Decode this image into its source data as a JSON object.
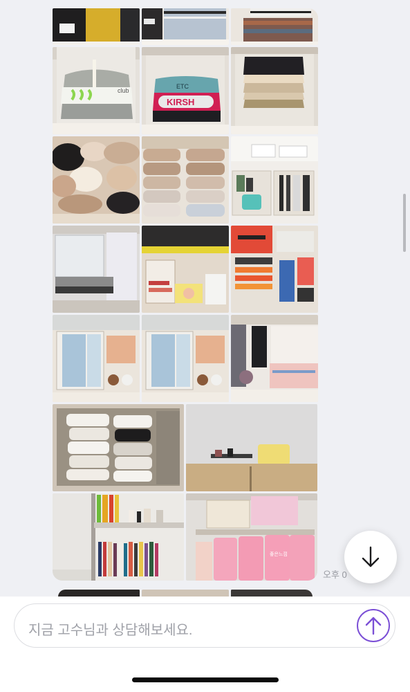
{
  "chat": {
    "timestamp": "오후 0",
    "photos": [
      {
        "name": "photo-folded-black-yellow-knits"
      },
      {
        "name": "photo-striped-knits-drawer"
      },
      {
        "name": "photo-folded-colorful-knits"
      },
      {
        "name": "photo-folded-sweatshirts-shelf"
      },
      {
        "name": "photo-kirsh-sweatshirt-shelf"
      },
      {
        "name": "photo-folded-dark-beige-tops"
      },
      {
        "name": "photo-underwear-drawer"
      },
      {
        "name": "photo-fleece-socks-drawer"
      },
      {
        "name": "photo-cosmetics-organizer"
      },
      {
        "name": "photo-plastic-bags-drawer"
      },
      {
        "name": "photo-mixed-items-drawer"
      },
      {
        "name": "photo-stationery-drawer"
      },
      {
        "name": "photo-masks-drawer-1"
      },
      {
        "name": "photo-masks-drawer-2"
      },
      {
        "name": "photo-bags-shelf"
      },
      {
        "name": "photo-towels-basket"
      },
      {
        "name": "photo-desk-corner"
      },
      {
        "name": "photo-bookshelf-perfume"
      },
      {
        "name": "photo-pink-boxes-shelf"
      }
    ],
    "photo_labels": {
      "club": "club",
      "etc": "ETC",
      "kirsh": "KIRSH",
      "brand_box": "좋은느낌"
    }
  },
  "composer": {
    "placeholder": "지금 고수님과 상담해보세요."
  },
  "icons": {
    "scroll_down": "arrow-down-icon",
    "send": "arrow-up-circle-icon"
  },
  "colors": {
    "accent": "#7b4fd6",
    "background": "#eff0f4"
  }
}
